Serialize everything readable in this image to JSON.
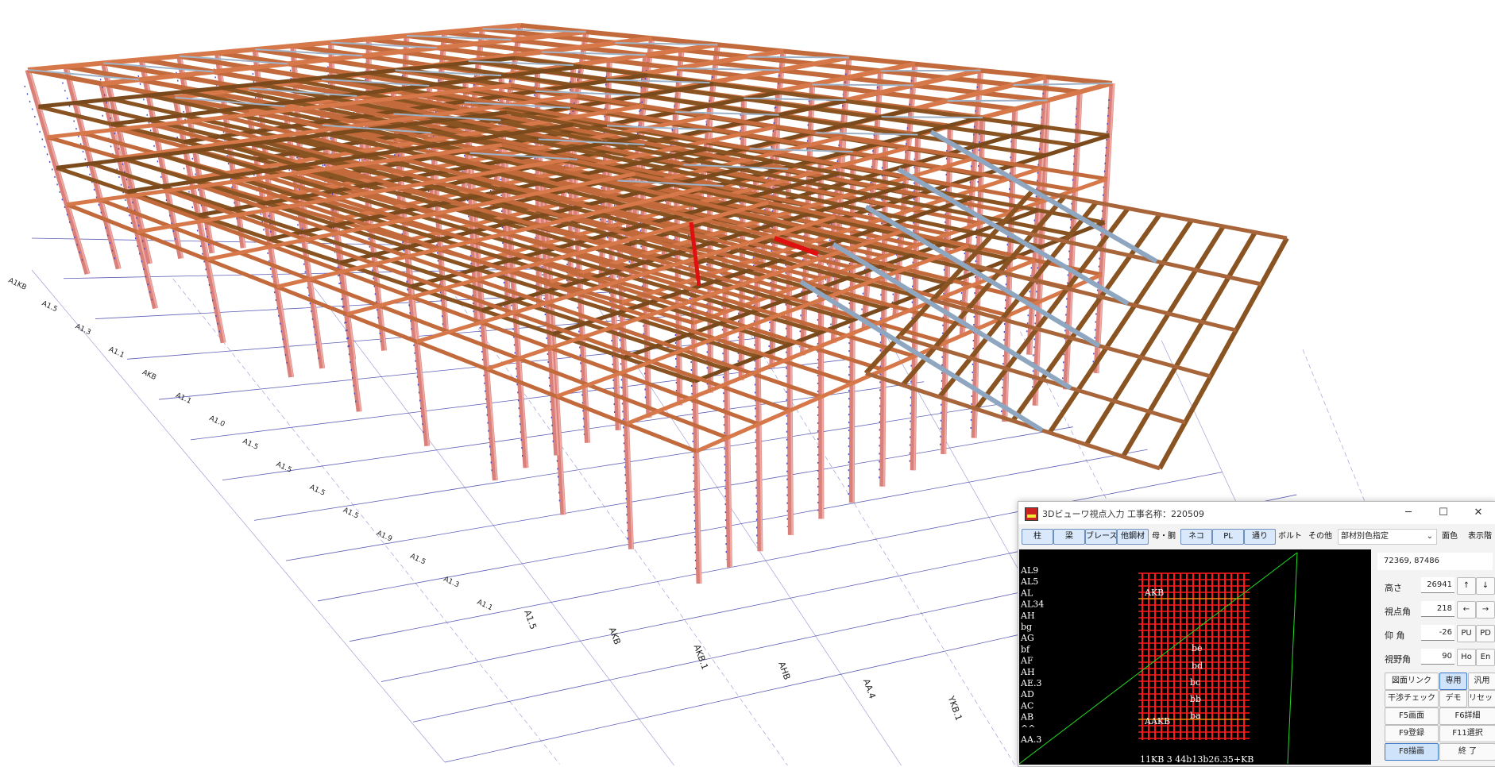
{
  "model": {
    "grid_labels": [
      "A1KB",
      "A1.5",
      "A1.3",
      "A1.1",
      "AKB",
      "A1.1",
      "A1.0",
      "A1.5",
      "A1.5",
      "A1.5",
      "A1.5",
      "A1.9",
      "A1.5",
      "A1.3",
      "A1.1"
    ],
    "grid_bottom_labels": [
      "A1.5",
      "AKB",
      "AKB.1",
      "AHB",
      "AA.4",
      "YKB.1",
      "A1.1"
    ]
  },
  "viewer": {
    "title": "3Dビューワ視点入力 工事名称：220509",
    "window_controls": {
      "minimize": "─",
      "maximize": "☐",
      "close": "✕"
    },
    "toolbar": {
      "buttons": [
        "柱",
        "梁",
        "ブレース",
        "他鋼材",
        "母・胴",
        "ネコ",
        "PL",
        "通り",
        "ボルト",
        "その他"
      ],
      "selected": [
        "柱",
        "梁",
        "ブレース",
        "他鋼材",
        "ネコ",
        "PL",
        "通り"
      ],
      "color_mode": "部材別色指定",
      "face_color": "面色",
      "display_floor": "表示階"
    },
    "plan": {
      "row_labels": [
        "AL9",
        "AL5",
        "AL",
        "AL34",
        "AH",
        "bg",
        "AG",
        "bf",
        "AF",
        "AH",
        "AE.3",
        "AD",
        "AC",
        "AB",
        "^^",
        "AA.3"
      ],
      "inner_labels": [
        "AKB",
        "AAKB",
        "be",
        "bd",
        "bc",
        "bb",
        "ba"
      ],
      "footer": "11KB 3 44b13b26.35+KB",
      "colors": {
        "background": "#000000",
        "grid": "#ff1a1a",
        "frustum": "#22dd22",
        "accent": "#f0c000"
      }
    },
    "panel": {
      "coords": "72369, 87486",
      "height_label": "高さ",
      "height_value": "26941",
      "view_angle_label": "視点角",
      "view_angle_value": "218",
      "elevation_label": "仰 角",
      "elevation_value": "-26",
      "fov_label": "視野角",
      "fov_value": "90",
      "up": "↑",
      "down": "↓",
      "left": "←",
      "right": "→",
      "pu": "PU",
      "pd": "PD",
      "ho": "Ho",
      "en": "En",
      "drawing_link": "図面リンク",
      "dedicated": "専用",
      "general": "汎用",
      "interference": "干渉チェック",
      "demo": "デモ",
      "reset": "リセット",
      "f5": "F5画面",
      "f6": "F6詳細",
      "f9": "F9登録",
      "f11": "F11選択",
      "f8": "F8描画",
      "close": "終 了"
    }
  }
}
